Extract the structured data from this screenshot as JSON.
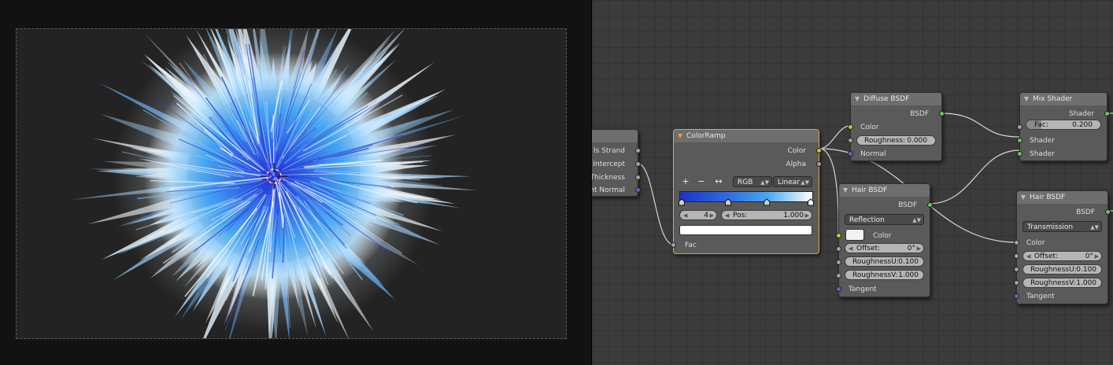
{
  "viewport": {
    "crosshair": "3d-cursor-icon"
  },
  "nodes": {
    "partial": {
      "outputs": [
        "Is Strand",
        "Intercept",
        "Thickness",
        "ent Normal"
      ]
    },
    "colorramp": {
      "title": "ColorRamp",
      "outputs": {
        "color": "Color",
        "alpha": "Alpha"
      },
      "tools": {
        "add": "+",
        "remove": "−",
        "flip": "↔"
      },
      "color_mode": "RGB",
      "interpolation": "Linear",
      "active_stop": "4",
      "pos_label": "Pos:",
      "pos_value": "1.000",
      "input": "Fac",
      "ramp_colors": [
        "#1e32c8",
        "#2f6be0",
        "#4aa6f0",
        "#ffffff"
      ],
      "stop_positions": [
        0.0,
        0.36,
        0.66,
        1.0
      ],
      "selected_color": "#ffffff"
    },
    "diffuse": {
      "title": "Diffuse BSDF",
      "output": "BSDF",
      "color_label": "Color",
      "roughness_label": "Roughness:",
      "roughness_value": "0.000",
      "normal_label": "Normal"
    },
    "mix": {
      "title": "Mix Shader",
      "output": "Shader",
      "fac_label": "Fac:",
      "fac_value": "0.200",
      "fac": 0.2,
      "inputs": [
        "Shader",
        "Shader"
      ]
    },
    "hair1": {
      "title": "Hair BSDF",
      "output": "BSDF",
      "component": "Reflection",
      "color_label": "Color",
      "offset_label": "Offset:",
      "offset_value": "0°",
      "roughness_u_label": "RoughnessU:",
      "roughness_u_value": "0.100",
      "roughness_v_label": "RoughnessV:",
      "roughness_v_value": "1.000",
      "tangent_label": "Tangent"
    },
    "hair2": {
      "title": "Hair BSDF",
      "output": "BSDF",
      "component": "Transmission",
      "color_label": "Color",
      "offset_label": "Offset:",
      "offset_value": "0°",
      "roughness_u_label": "RoughnessU:",
      "roughness_u_value": "0.100",
      "roughness_v_label": "RoughnessV:",
      "roughness_v_value": "1.000",
      "tangent_label": "Tangent"
    }
  },
  "colors": {
    "socket_shader": "#63c763",
    "socket_color": "#c7c729",
    "socket_float": "#a1a1a1",
    "socket_vector": "#6363c7",
    "active_outline": "#e8a03c",
    "wire": "#d6d6d6"
  }
}
